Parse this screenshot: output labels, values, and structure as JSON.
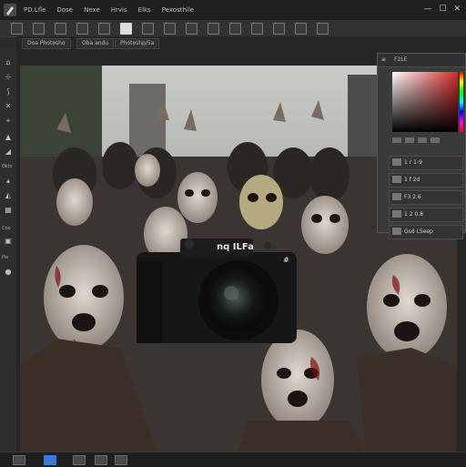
{
  "app": {
    "window_controls": [
      "—",
      "☐",
      "✕"
    ]
  },
  "menu": [
    "PD.Lfle",
    "Dose",
    "Nexe",
    "Hrvis",
    "Elks",
    "Pexosthile"
  ],
  "tabs": [
    "Doa Photosho",
    "Oba andu",
    "Photoshp/5a"
  ],
  "toolbar": {
    "labels": [
      "Oktx",
      "Coo",
      "Pie"
    ]
  },
  "camera": {
    "brand_text": "nq ILFa",
    "brand_right": "#"
  },
  "panel": {
    "title": "F2LE",
    "layers": [
      "1 r 1-9",
      "1 f 2d",
      "F3 2.6",
      "1 2 0.8",
      "Gsd L5eep"
    ]
  },
  "colors": {
    "bg": "#2b2b2b",
    "accent": "#3a7bd5",
    "picker_red": "#d42a2a"
  }
}
